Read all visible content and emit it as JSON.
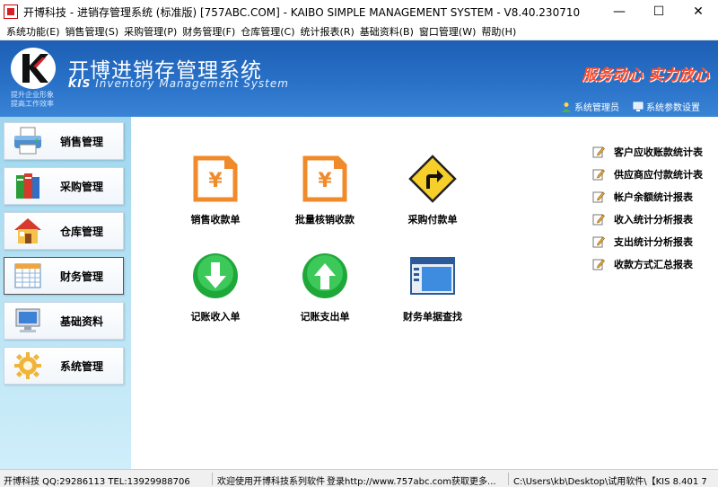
{
  "window": {
    "title": "开博科技 - 进销存管理系统 (标准版) [757ABC.COM] - KAIBO SIMPLE MANAGEMENT SYSTEM - V8.40.230710",
    "minimize": "—",
    "maximize": "☐",
    "close": "✕"
  },
  "menu": [
    {
      "label": "系统功能(E)"
    },
    {
      "label": "销售管理(S)"
    },
    {
      "label": "采购管理(P)"
    },
    {
      "label": "财务管理(F)"
    },
    {
      "label": "仓库管理(C)"
    },
    {
      "label": "统计报表(R)"
    },
    {
      "label": "基础资料(B)"
    },
    {
      "label": "窗口管理(W)"
    },
    {
      "label": "帮助(H)"
    }
  ],
  "header": {
    "title": "开博进销存管理系统",
    "subtitle_kis": "KIS",
    "subtitle_rest": " Inventory Management System",
    "slogan1": "提升企业形象",
    "slogan2": "提高工作效率",
    "tagline": "服务动心 实力放心",
    "link_admin": "系统管理员",
    "link_settings": "系统参数设置"
  },
  "sidebar": [
    {
      "label": "销售管理",
      "icon": "printer-icon"
    },
    {
      "label": "采购管理",
      "icon": "books-icon"
    },
    {
      "label": "仓库管理",
      "icon": "house-icon"
    },
    {
      "label": "财务管理",
      "icon": "spreadsheet-icon"
    },
    {
      "label": "基础资料",
      "icon": "monitor-icon"
    },
    {
      "label": "系统管理",
      "icon": "gear-icon"
    }
  ],
  "functions": [
    {
      "label": "销售收款单",
      "icon": "yen-document-icon"
    },
    {
      "label": "批量核销收款",
      "icon": "yen-document-icon"
    },
    {
      "label": "采购付款单",
      "icon": "turn-sign-icon"
    },
    {
      "label": "记账收入单",
      "icon": "down-arrow-icon"
    },
    {
      "label": "记账支出单",
      "icon": "up-arrow-icon"
    },
    {
      "label": "财务单据查找",
      "icon": "window-search-icon"
    }
  ],
  "reports": [
    {
      "label": "客户应收账款统计表"
    },
    {
      "label": "供应商应付款统计表"
    },
    {
      "label": "帐户余额统计报表"
    },
    {
      "label": "收入统计分析报表"
    },
    {
      "label": "支出统计分析报表"
    },
    {
      "label": "收款方式汇总报表"
    }
  ],
  "status": {
    "company": "开博科技 QQ:29286113 TEL:13929988706",
    "welcome": "欢迎使用开博科技系列软件",
    "login": "登录http://www.757abc.com获取更多...",
    "path": "C:\\Users\\kb\\Desktop\\试用软件\\【KIS 8.401 7"
  },
  "colors": {
    "header_blue": "#2a73c9",
    "tagline_red": "#ff4a2a",
    "doc_orange": "#f08a2a",
    "arrow_green": "#1fa83a"
  }
}
